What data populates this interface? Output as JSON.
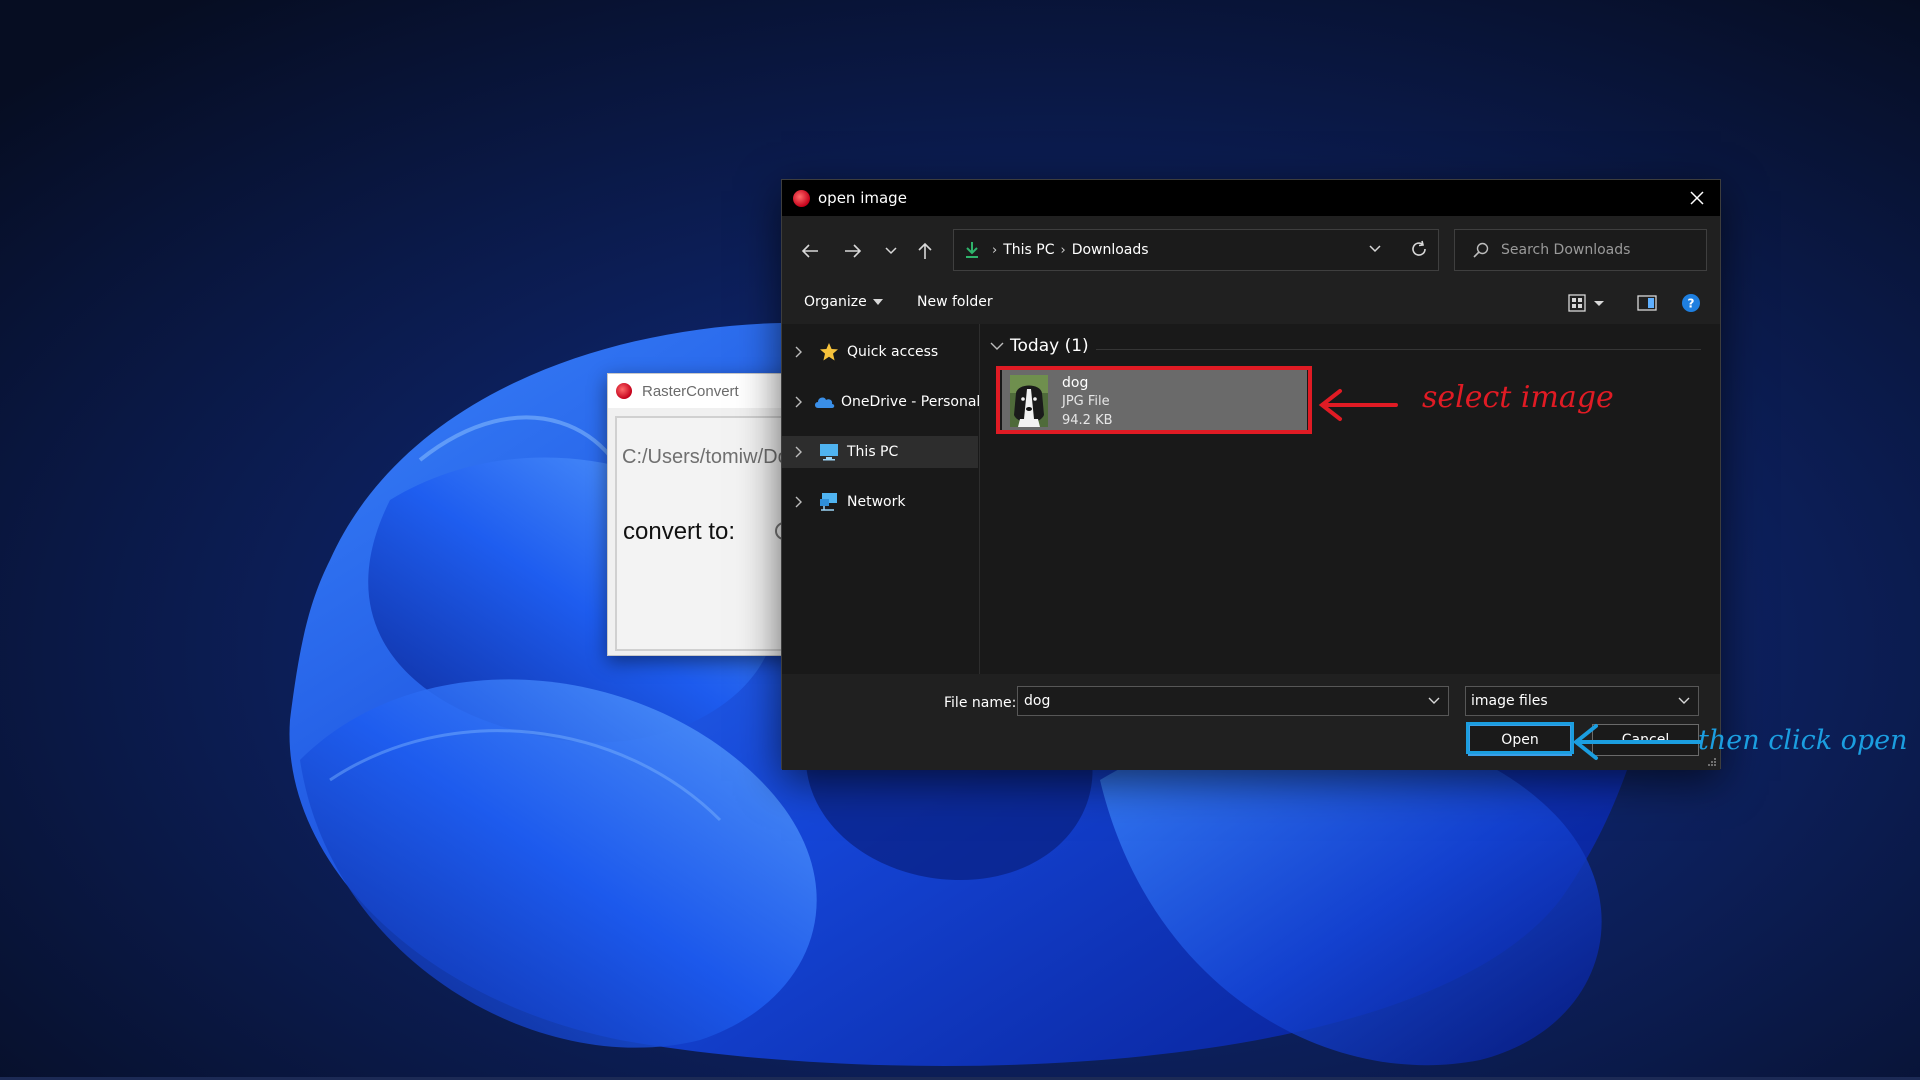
{
  "rasterconvert": {
    "title": "RasterConvert",
    "path_field": "C:/Users/tomiw/Do",
    "convert_label": "convert to:"
  },
  "dialog": {
    "title": "open image",
    "breadcrumb": [
      "This PC",
      "Downloads"
    ],
    "search_placeholder": "Search Downloads",
    "toolbar": {
      "organize": "Organize",
      "new_folder": "New folder"
    },
    "sidebar": {
      "items": [
        {
          "label": "Quick access",
          "icon": "star-icon"
        },
        {
          "label": "OneDrive - Personal",
          "icon": "cloud-icon"
        },
        {
          "label": "This PC",
          "icon": "monitor-icon",
          "selected": true
        },
        {
          "label": "Network",
          "icon": "network-icon"
        }
      ]
    },
    "group_header": "Today (1)",
    "file": {
      "name": "dog",
      "type": "JPG File",
      "size": "94.2 KB"
    },
    "file_name_label": "File name:",
    "file_name_value": "dog",
    "file_type_value": "image files",
    "open_label": "Open",
    "cancel_label": "Cancel"
  },
  "annotations": {
    "select_text": "select image",
    "open_text": "then click open",
    "select_color": "#e01b24",
    "open_color": "#1b9ee0"
  }
}
